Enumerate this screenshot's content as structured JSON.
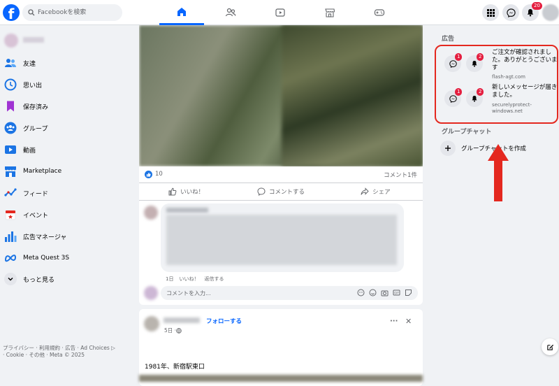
{
  "topbar": {
    "logo": "f",
    "search_placeholder": "Facebookを検索",
    "notification_badge": "20",
    "nav_tabs": [
      "home-icon",
      "friends-icon",
      "video-icon",
      "marketplace-icon",
      "gaming-icon"
    ]
  },
  "sidebar": {
    "items": [
      {
        "label": "友達",
        "icon": "friends-icon"
      },
      {
        "label": "思い出",
        "icon": "memories-icon"
      },
      {
        "label": "保存済み",
        "icon": "saved-icon"
      },
      {
        "label": "グループ",
        "icon": "groups-icon"
      },
      {
        "label": "動画",
        "icon": "video-icon"
      },
      {
        "label": "Marketplace",
        "icon": "marketplace-icon"
      },
      {
        "label": "フィード",
        "icon": "feed-icon"
      },
      {
        "label": "イベント",
        "icon": "events-icon"
      },
      {
        "label": "広告マネージャ",
        "icon": "ads-manager-icon"
      },
      {
        "label": "Meta Quest 3S",
        "icon": "meta-icon"
      },
      {
        "label": "もっと見る",
        "icon": "chevron-down-icon"
      }
    ],
    "footer_line1": "プライバシー · 利用規約 · 広告 · Ad Choices ▷",
    "footer_line2": "· Cookie · その他 · Meta © 2025"
  },
  "post": {
    "like_count": "10",
    "comment_count": "コメント1件",
    "like_label": "いいね！",
    "comment_label": "コメントする",
    "share_label": "シェア",
    "comment_meta": {
      "time": "1日",
      "like": "いいね！",
      "reply": "返信する"
    },
    "comment_input_placeholder": "コメントを入力..."
  },
  "post2": {
    "follow_label": "フォローする",
    "time": "5日 · ",
    "text": "1981年、新宿駅東口",
    "more": "···",
    "close": "✕"
  },
  "right": {
    "ads_heading": "広告",
    "ads": [
      {
        "text": "ご注文が確認されました。ありがとうございます",
        "url": "flash-agt.com",
        "badge1": "1",
        "badge2": "2"
      },
      {
        "text": "新しいメッセージが届きました。",
        "url": "securelyprotect-windows.net",
        "badge1": "1",
        "badge2": "2"
      }
    ],
    "group_chat_heading": "グループチャット",
    "create_group_label": "グループチャットを作成"
  },
  "colors": {
    "accent": "#0866ff",
    "highlight": "#e4281f",
    "badge": "#e41e3f"
  }
}
